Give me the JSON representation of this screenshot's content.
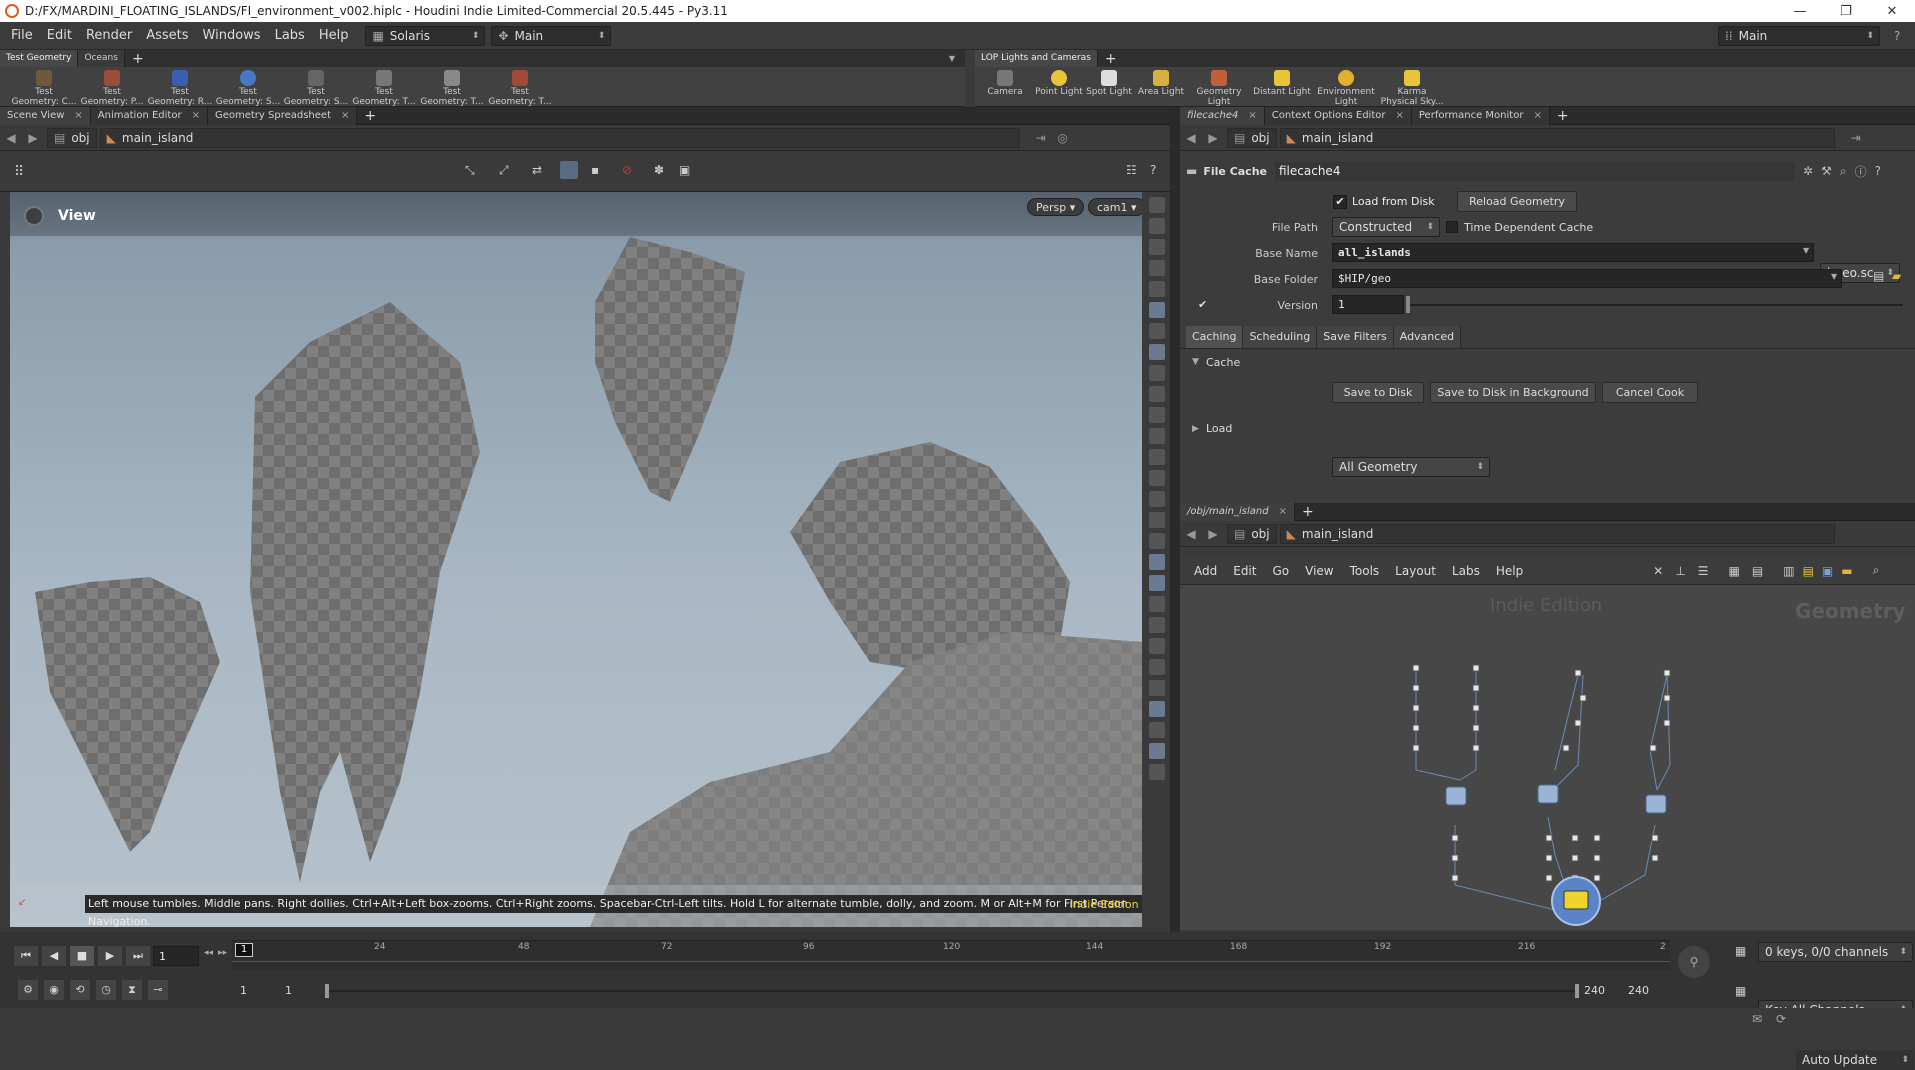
{
  "window": {
    "title": "D:/FX/MARDINI_FLOATING_ISLANDS/FI_environment_v002.hiplc - Houdini Indie Limited-Commercial 20.5.445 - Py3.11",
    "minimize": "—",
    "maximize": "❐",
    "close": "✕"
  },
  "menubar": {
    "items": [
      "File",
      "Edit",
      "Render",
      "Assets",
      "Windows",
      "Labs",
      "Help"
    ],
    "desktop": "Solaris",
    "context": "Main",
    "right_desktop": "Main"
  },
  "shelf_left": {
    "tabs": [
      "Test Geometry",
      "Oceans"
    ],
    "tools": [
      {
        "line1": "Test",
        "line2": "Geometry: C...",
        "icon": "crag-icon"
      },
      {
        "line1": "Test",
        "line2": "Geometry: P...",
        "icon": "pig-icon"
      },
      {
        "line1": "Test",
        "line2": "Geometry: R...",
        "icon": "rubbertoy-icon"
      },
      {
        "line1": "Test",
        "line2": "Geometry: S...",
        "icon": "shaderball-icon"
      },
      {
        "line1": "Test",
        "line2": "Geometry: S...",
        "icon": "squab-icon"
      },
      {
        "line1": "Test",
        "line2": "Geometry: T...",
        "icon": "template-icon"
      },
      {
        "line1": "Test",
        "line2": "Geometry: T...",
        "icon": "tommy-icon"
      },
      {
        "line1": "Test",
        "line2": "Geometry: T...",
        "icon": "torus-icon"
      }
    ]
  },
  "shelf_right": {
    "tabs": [
      "LOP Lights and Cameras"
    ],
    "tools": [
      {
        "line1": "Camera",
        "line2": "",
        "icon": "camera-icon"
      },
      {
        "line1": "Point Light",
        "line2": "",
        "icon": "point-light-icon"
      },
      {
        "line1": "Spot Light",
        "line2": "",
        "icon": "spot-light-icon"
      },
      {
        "line1": "Area Light",
        "line2": "",
        "icon": "area-light-icon"
      },
      {
        "line1": "Geometry",
        "line2": "Light",
        "icon": "geometry-light-icon"
      },
      {
        "line1": "Distant Light",
        "line2": "",
        "icon": "distant-light-icon"
      },
      {
        "line1": "Environment",
        "line2": "Light",
        "icon": "environment-light-icon"
      },
      {
        "line1": "Karma",
        "line2": "Physical Sky...",
        "icon": "karma-sky-icon"
      }
    ]
  },
  "left_pane": {
    "tabs": [
      "Scene View",
      "Animation Editor",
      "Geometry Spreadsheet"
    ],
    "path": [
      "obj",
      "main_island"
    ],
    "view_label": "View",
    "persp": "Persp",
    "camera": "cam1",
    "hint": "Left mouse tumbles. Middle pans. Right dollies. Ctrl+Alt+Left box-zooms. Ctrl+Right zooms. Spacebar-Ctrl-Left tilts. Hold L for alternate tumble, dolly, and zoom. M or Alt+M for First Person Navigation.",
    "edition": "Indie Edition"
  },
  "param_pane": {
    "tabs": [
      "filecache4",
      "Context Options Editor",
      "Performance Monitor"
    ],
    "path": [
      "obj",
      "main_island"
    ],
    "node_type": "File Cache",
    "node_name": "filecache4",
    "load_from_disk": "Load from Disk",
    "reload": "Reload Geometry",
    "file_path_label": "File Path",
    "file_path_value": "Constructed",
    "time_dependent": "Time Dependent Cache",
    "base_name_label": "Base Name",
    "base_name_value": "all_islands",
    "ext": "bgeo.sc",
    "base_folder_label": "Base Folder",
    "base_folder_value": "$HIP/geo",
    "version_label": "Version",
    "version_value": "1",
    "subtabs": [
      "Caching",
      "Scheduling",
      "Save Filters",
      "Advanced"
    ],
    "cache_section": "Cache",
    "save_to_disk": "Save to Disk",
    "save_bg": "Save to Disk in Background",
    "cancel_cook": "Cancel Cook",
    "load_section": "Load",
    "load_value": "All Geometry"
  },
  "network_pane": {
    "tabs": [
      "/obj/main_island"
    ],
    "path": [
      "obj",
      "main_island"
    ],
    "menu": [
      "Add",
      "Edit",
      "Go",
      "View",
      "Tools",
      "Layout",
      "Labs",
      "Help"
    ],
    "watermark": "Indie Edition",
    "context": "Geometry"
  },
  "timeline": {
    "frame": "1",
    "current_marker": "1",
    "ticks": [
      "24",
      "48",
      "72",
      "96",
      "120",
      "144",
      "168",
      "192",
      "216",
      "2"
    ],
    "range_start": "1",
    "range_start2": "1",
    "range_end": "240",
    "range_end2": "240",
    "keys": "0 keys, 0/0 channels",
    "key_all": "Key All Channels",
    "auto_update": "Auto Update"
  }
}
